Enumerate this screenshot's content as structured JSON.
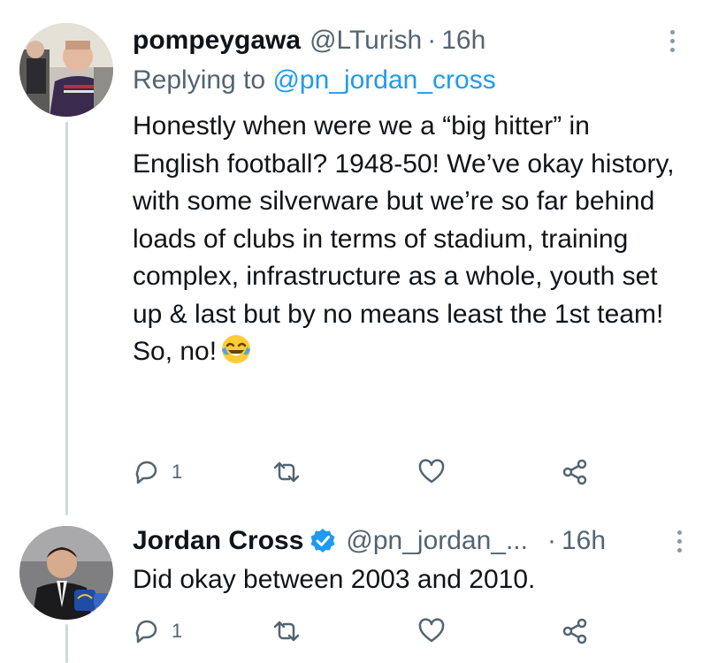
{
  "tweets": [
    {
      "display_name": "pompeygawa",
      "handle": "@LTurish",
      "separator": "·",
      "time": "16h",
      "replying_prefix": "Replying to",
      "replying_to": "@pn_jordan_cross",
      "text": "Honestly when were we a “big hitter” in English football? 1948-50! We’ve okay history, with some silverware but we’re so far behind loads of clubs in terms of stadium, training complex, infrastructure as a whole, youth set up & last but by no means least the 1st team! So, no!",
      "emoji_icon": "face-with-tears-of-joy-icon",
      "reply_count": "1"
    },
    {
      "display_name": "Jordan Cross",
      "verified": true,
      "handle": "@pn_jordan_...",
      "separator": "·",
      "time": "16h",
      "text": "Did okay between 2003 and 2010.",
      "reply_count": "1"
    }
  ],
  "colors": {
    "text": "#0f1419",
    "secondary": "#536471",
    "link": "#1d9bf0",
    "thread_line": "#cfd9de",
    "verified": "#1d9bf0"
  },
  "icons": [
    "reply-icon",
    "retweet-icon",
    "like-icon",
    "share-icon",
    "more-options-icon",
    "verified-badge-icon"
  ]
}
